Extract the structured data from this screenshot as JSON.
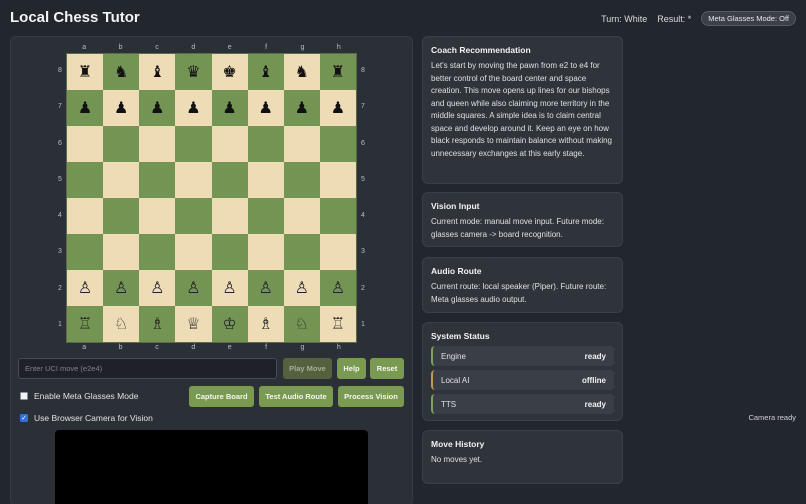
{
  "app": {
    "title": "Local Chess Tutor"
  },
  "header": {
    "turn": "Turn: White",
    "result": "Result: *",
    "meta_mode": "Meta Glasses Mode: Off"
  },
  "board": {
    "files": [
      "a",
      "b",
      "c",
      "d",
      "e",
      "f",
      "g",
      "h"
    ],
    "ranks": [
      "8",
      "7",
      "6",
      "5",
      "4",
      "3",
      "2",
      "1"
    ],
    "rows": [
      [
        "♜",
        "♞",
        "♝",
        "♛",
        "♚",
        "♝",
        "♞",
        "♜"
      ],
      [
        "♟",
        "♟",
        "♟",
        "♟",
        "♟",
        "♟",
        "♟",
        "♟"
      ],
      [
        "",
        "",
        "",
        "",
        "",
        "",
        "",
        ""
      ],
      [
        "",
        "",
        "",
        "",
        "",
        "",
        "",
        ""
      ],
      [
        "",
        "",
        "",
        "",
        "",
        "",
        "",
        ""
      ],
      [
        "",
        "",
        "",
        "",
        "",
        "",
        "",
        ""
      ],
      [
        "♙",
        "♙",
        "♙",
        "♙",
        "♙",
        "♙",
        "♙",
        "♙"
      ],
      [
        "♖",
        "♘",
        "♗",
        "♕",
        "♔",
        "♗",
        "♘",
        "♖"
      ]
    ],
    "light_color": "#eedcb7",
    "dark_color": "#749454"
  },
  "controls": {
    "uci_placeholder": "Enter UCI move (e2e4)",
    "play_move": "Play Move",
    "help": "Help",
    "reset": "Reset",
    "enable_meta": "Enable Meta Glasses Mode",
    "use_camera": "Use Browser Camera for Vision",
    "capture_board": "Capture Board",
    "test_audio": "Test Audio Route",
    "process_vision": "Process Vision",
    "camera_status": "Camera ready"
  },
  "coach": {
    "title": "Coach Recommendation",
    "text": "Let's start by moving the pawn from e2 to e4 for better control of the board center and space creation. This move opens up lines for our bishops and queen while also claiming more territory in the middle squares. A simple idea is to claim central space and develop around it. Keep an eye on how black responds to maintain balance without making unnecessary exchanges at this early stage."
  },
  "vision": {
    "title": "Vision Input",
    "text": "Current mode: manual move input. Future mode: glasses camera -> board recognition."
  },
  "audio": {
    "title": "Audio Route",
    "text": "Current route: local speaker (Piper). Future route: Meta glasses audio output."
  },
  "system": {
    "title": "System Status",
    "items": [
      {
        "label": "Engine",
        "value": "ready"
      },
      {
        "label": "Local AI",
        "value": "offline"
      },
      {
        "label": "TTS",
        "value": "ready"
      }
    ]
  },
  "history": {
    "title": "Move History",
    "text": "No moves yet."
  },
  "colors": {
    "accent": "#7a9a52",
    "background": "#22262d",
    "card": "#2f343b"
  }
}
